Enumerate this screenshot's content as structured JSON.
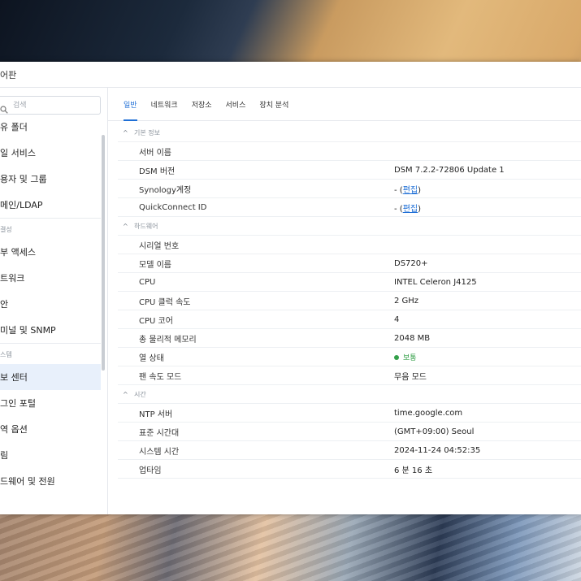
{
  "window": {
    "title": "어판"
  },
  "sidebar": {
    "search_placeholder": "검색",
    "items": [
      {
        "label": "유 폴더",
        "type": "item"
      },
      {
        "label": "일 서비스",
        "type": "item"
      },
      {
        "label": "용자 및 그룹",
        "type": "item"
      },
      {
        "label": "메인/LDAP",
        "type": "item"
      },
      {
        "label": "결성",
        "type": "group"
      },
      {
        "label": "부 액세스",
        "type": "item"
      },
      {
        "label": "트워크",
        "type": "item"
      },
      {
        "label": "안",
        "type": "item"
      },
      {
        "label": "미널 및 SNMP",
        "type": "item"
      },
      {
        "label": "스템",
        "type": "group"
      },
      {
        "label": "보 센터",
        "type": "item",
        "active": true
      },
      {
        "label": "그인 포털",
        "type": "item"
      },
      {
        "label": "역 옵션",
        "type": "item"
      },
      {
        "label": "림",
        "type": "item"
      },
      {
        "label": "드웨어 및 전원",
        "type": "item"
      }
    ]
  },
  "tabs": [
    {
      "label": "일반",
      "active": true
    },
    {
      "label": "네트워크"
    },
    {
      "label": "저장소"
    },
    {
      "label": "서비스"
    },
    {
      "label": "장치 분석"
    }
  ],
  "sections": [
    {
      "title": "기본 정보",
      "rows": [
        {
          "key": "서버 이름",
          "value": ""
        },
        {
          "key": "DSM 버전",
          "value": "DSM 7.2.2-72806 Update 1"
        },
        {
          "key": "Synology계정",
          "value": "- (",
          "link": "편집",
          "suffix": ")"
        },
        {
          "key": "QuickConnect ID",
          "value": "- (",
          "link": "편집",
          "suffix": ")"
        }
      ]
    },
    {
      "title": "하드웨어",
      "rows": [
        {
          "key": "시리얼 번호",
          "value": ""
        },
        {
          "key": "모델 이름",
          "value": "DS720+"
        },
        {
          "key": "CPU",
          "value": "INTEL Celeron J4125"
        },
        {
          "key": "CPU 클럭 속도",
          "value": "2 GHz"
        },
        {
          "key": "CPU 코어",
          "value": "4"
        },
        {
          "key": "총 물리적 메모리",
          "value": "2048 MB"
        },
        {
          "key": "열 상태",
          "status": "보통",
          "status_color": "#33a04a"
        },
        {
          "key": "팬 속도 모드",
          "value": "무음 모드"
        }
      ]
    },
    {
      "title": "시간",
      "rows": [
        {
          "key": "NTP 서버",
          "value": "time.google.com"
        },
        {
          "key": "표준 시간대",
          "value": "(GMT+09:00) Seoul"
        },
        {
          "key": "시스템 시간",
          "value": "2024-11-24 04:52:35"
        },
        {
          "key": "업타임",
          "value": "6 분 16 초"
        }
      ]
    }
  ],
  "colors": {
    "accent": "#1f6fd6",
    "active_bg": "#e8f0fb"
  }
}
